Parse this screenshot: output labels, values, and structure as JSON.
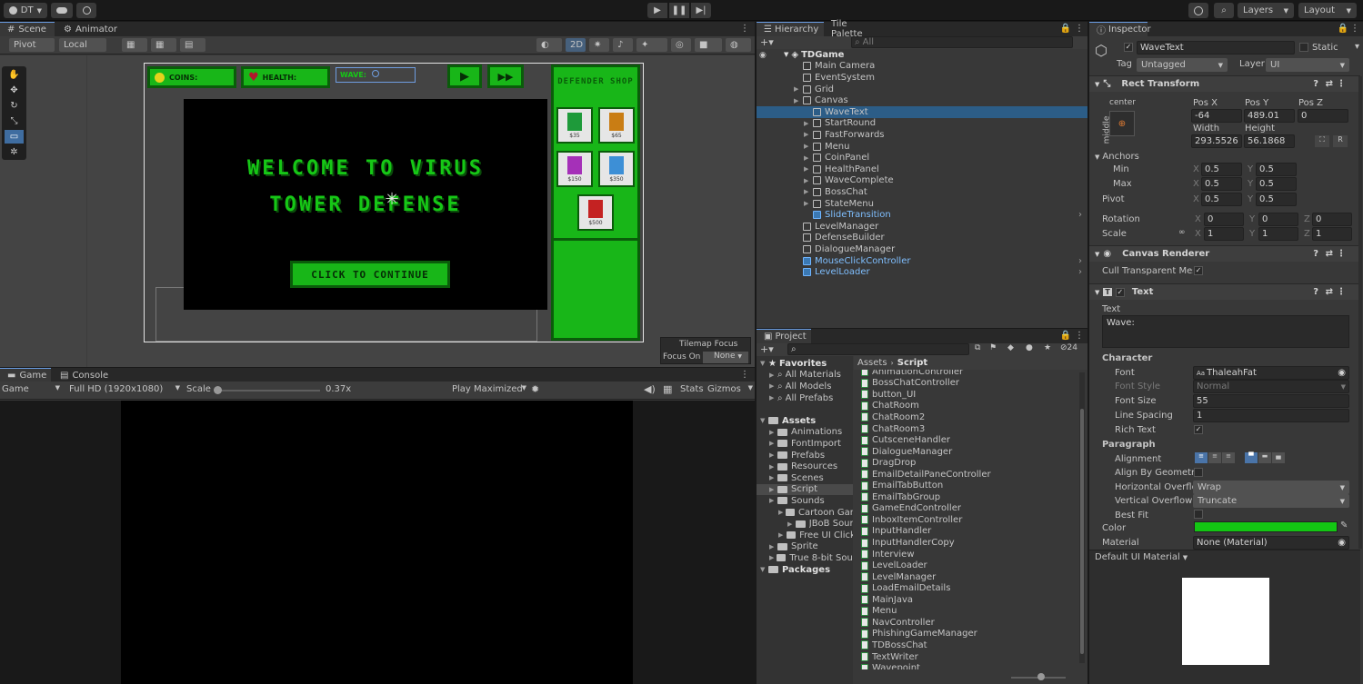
{
  "toolbar": {
    "account": "DT",
    "layers": "Layers",
    "layout": "Layout"
  },
  "scene": {
    "tabs": [
      "Scene",
      "Animator"
    ],
    "pivot": "Pivot",
    "local": "Local",
    "mode2d": "2D",
    "tilemap_focus_title": "Tilemap Focus",
    "focus_on_label": "Focus On",
    "focus_on_value": "None",
    "hud": {
      "coins": "COINS:",
      "health": "HEALTH:",
      "wave": "WAVE:"
    },
    "welcome_line1": "WELCOME TO VIRUS",
    "welcome_line2": "TOWER DEFENSE",
    "continue": "CLICK TO CONTINUE",
    "shop_title": "DEFENDER SHOP",
    "prices": [
      "$35",
      "$65",
      "$150",
      "$350",
      "$500"
    ]
  },
  "game": {
    "tabs": [
      "Game",
      "Console"
    ],
    "display": "Game",
    "resolution": "Full HD (1920x1080)",
    "scale_label": "Scale",
    "scale_value": "0.37x",
    "play_mode": "Play Maximized",
    "stats": "Stats",
    "gizmos": "Gizmos"
  },
  "hierarchy": {
    "tabs": [
      "Hierarchy",
      "Tile Palette"
    ],
    "search_placeholder": "All",
    "scene": "TDGame",
    "items": [
      {
        "label": "Main Camera",
        "depth": 1,
        "arrow": false
      },
      {
        "label": "EventSystem",
        "depth": 1,
        "arrow": false
      },
      {
        "label": "Grid",
        "depth": 1,
        "arrow": true
      },
      {
        "label": "Canvas",
        "depth": 1,
        "arrow": true
      },
      {
        "label": "WaveText",
        "depth": 2,
        "arrow": false,
        "selected": true
      },
      {
        "label": "StartRound",
        "depth": 2,
        "arrow": true
      },
      {
        "label": "FastForwards",
        "depth": 2,
        "arrow": true
      },
      {
        "label": "Menu",
        "depth": 2,
        "arrow": true
      },
      {
        "label": "CoinPanel",
        "depth": 2,
        "arrow": true
      },
      {
        "label": "HealthPanel",
        "depth": 2,
        "arrow": true
      },
      {
        "label": "WaveComplete",
        "depth": 2,
        "arrow": true
      },
      {
        "label": "BossChat",
        "depth": 2,
        "arrow": true
      },
      {
        "label": "StateMenu",
        "depth": 2,
        "arrow": true
      },
      {
        "label": "SlideTransition",
        "depth": 2,
        "arrow": false,
        "prefab": true
      },
      {
        "label": "LevelManager",
        "depth": 1,
        "arrow": false
      },
      {
        "label": "DefenseBuilder",
        "depth": 1,
        "arrow": false
      },
      {
        "label": "DialogueManager",
        "depth": 1,
        "arrow": false
      },
      {
        "label": "MouseClickController",
        "depth": 1,
        "arrow": false,
        "prefab": true
      },
      {
        "label": "LevelLoader",
        "depth": 1,
        "arrow": false,
        "prefab": true
      }
    ]
  },
  "project": {
    "tab": "Project",
    "count": "24",
    "breadcrumb": [
      "Assets",
      "Script"
    ],
    "tree": [
      {
        "label": "Favorites",
        "depth": 0,
        "bold": true
      },
      {
        "label": "All Materials",
        "depth": 1
      },
      {
        "label": "All Models",
        "depth": 1
      },
      {
        "label": "All Prefabs",
        "depth": 1
      },
      {
        "label": "",
        "depth": 0
      },
      {
        "label": "Assets",
        "depth": 0,
        "bold": true
      },
      {
        "label": "Animations",
        "depth": 1
      },
      {
        "label": "FontImport",
        "depth": 1
      },
      {
        "label": "Prefabs",
        "depth": 1
      },
      {
        "label": "Resources",
        "depth": 1
      },
      {
        "label": "Scenes",
        "depth": 1
      },
      {
        "label": "Script",
        "depth": 1,
        "selected": true
      },
      {
        "label": "Sounds",
        "depth": 1
      },
      {
        "label": "Cartoon Gam",
        "depth": 2
      },
      {
        "label": "JBoB Sour",
        "depth": 3
      },
      {
        "label": "Free UI Click",
        "depth": 2
      },
      {
        "label": "Sprite",
        "depth": 1
      },
      {
        "label": "True 8-bit Soun",
        "depth": 1
      },
      {
        "label": "Packages",
        "depth": 0,
        "bold": true
      }
    ],
    "files": [
      "AnimationController",
      "BossChatController",
      "button_UI",
      "ChatRoom",
      "ChatRoom2",
      "ChatRoom3",
      "CutsceneHandler",
      "DialogueManager",
      "DragDrop",
      "EmailDetailPaneController",
      "EmailTabButton",
      "EmailTabGroup",
      "GameEndController",
      "InboxItemController",
      "InputHandler",
      "InputHandlerCopy",
      "Interview",
      "LevelLoader",
      "LevelManager",
      "LoadEmailDetails",
      "MainJava",
      "Menu",
      "NavController",
      "PhishingGameManager",
      "TDBossChat",
      "TextWriter",
      "Wavepoint"
    ]
  },
  "inspector": {
    "tab": "Inspector",
    "object_name": "WaveText",
    "static_label": "Static",
    "tag_label": "Tag",
    "tag_value": "Untagged",
    "layer_label": "Layer",
    "layer_value": "UI",
    "rect_transform": {
      "title": "Rect Transform",
      "anchor_h": "center",
      "anchor_v": "middle",
      "pos_x_label": "Pos X",
      "pos_x": "-64",
      "pos_y_label": "Pos Y",
      "pos_y": "489.01",
      "pos_z_label": "Pos Z",
      "pos_z": "0",
      "width_label": "Width",
      "width": "293.5526",
      "height_label": "Height",
      "height": "56.1868",
      "anchors_label": "Anchors",
      "min_label": "Min",
      "min_x": "0.5",
      "min_y": "0.5",
      "max_label": "Max",
      "max_x": "0.5",
      "max_y": "0.5",
      "pivot_label": "Pivot",
      "pivot_x": "0.5",
      "pivot_y": "0.5",
      "rotation_label": "Rotation",
      "rot_x": "0",
      "rot_y": "0",
      "rot_z": "0",
      "scale_label": "Scale",
      "scale_x": "1",
      "scale_y": "1",
      "scale_z": "1"
    },
    "canvas_renderer": {
      "title": "Canvas Renderer",
      "cull_label": "Cull Transparent Mesh"
    },
    "text": {
      "title": "Text",
      "text_label": "Text",
      "text_value": "Wave:",
      "character_label": "Character",
      "font_label": "Font",
      "font_value": "ThaleahFat",
      "font_style_label": "Font Style",
      "font_style_value": "Normal",
      "font_size_label": "Font Size",
      "font_size_value": "55",
      "line_spacing_label": "Line Spacing",
      "line_spacing_value": "1",
      "rich_text_label": "Rich Text",
      "paragraph_label": "Paragraph",
      "alignment_label": "Alignment",
      "align_geo_label": "Align By Geometry",
      "h_overflow_label": "Horizontal Overflow",
      "h_overflow_value": "Wrap",
      "v_overflow_label": "Vertical Overflow",
      "v_overflow_value": "Truncate",
      "best_fit_label": "Best Fit",
      "color_label": "Color",
      "color_value": "#13c613",
      "material_label": "Material",
      "material_value": "None (Material)"
    },
    "default_material": "Default UI Material"
  }
}
